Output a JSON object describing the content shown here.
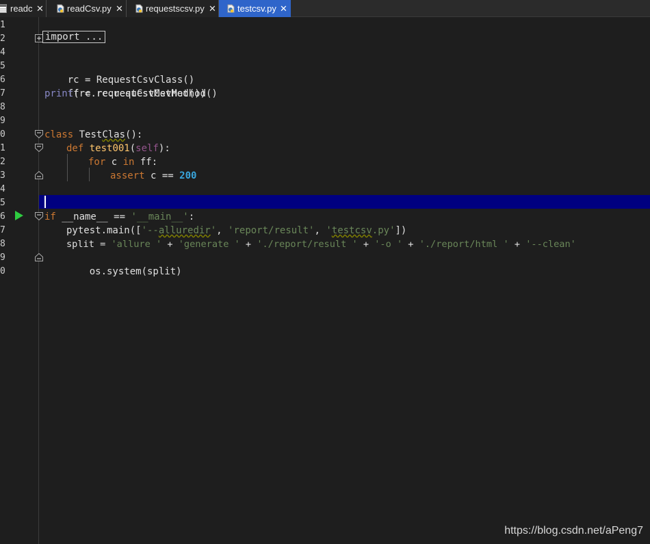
{
  "tabs": [
    {
      "label": "readc",
      "active": false
    },
    {
      "label": "readCsv.py",
      "active": false
    },
    {
      "label": "requestscsv.py",
      "active": false
    },
    {
      "label": "testcsv.py",
      "active": true
    }
  ],
  "tab_close_glyph": "✕",
  "line_numbers": [
    "1",
    "2",
    "4",
    "5",
    "6",
    "7",
    "8",
    "9",
    "0",
    "1",
    "2",
    "3",
    "4",
    "5",
    "6",
    "7",
    "8",
    "9",
    "0"
  ],
  "code": {
    "import_fold": "import ...",
    "l5_a": "rc = RequestCsvClass()",
    "l6_a": "ff = rc.requestCsvMethod()",
    "l7_print": "print",
    "l7_rest": "(rc.requestCsvMethod())",
    "l10_class": "class",
    "l10_name1": " Test",
    "l10_name2": "Clas",
    "l10_rest": "():",
    "l11_def": "def",
    "l11_fn": " test001",
    "l11_p1": "(",
    "l11_self": "self",
    "l11_p2": "):",
    "l12_for": "for",
    "l12_c": " c ",
    "l12_in": "in",
    "l12_ff": " ff:",
    "l13_assert": "assert",
    "l13_mid": " c == ",
    "l13_num": "200",
    "l16_if": "if",
    "l16_mid": " __name__ == ",
    "l16_str": "'__main__'",
    "l16_end": ":",
    "l17_a": "pytest.main([",
    "l17_s1a": "'--",
    "l17_s1b": "alluredir",
    "l17_s1c": "'",
    "l17_c1": ", ",
    "l17_s2": "'report/result'",
    "l17_c2": ", ",
    "l17_s3a": "'",
    "l17_s3b": "testcsv",
    "l17_s3c": ".py'",
    "l17_end": "])",
    "l18_a": "split = ",
    "l18_s1": "'allure '",
    "l18_p1": " + ",
    "l18_s2": "'generate '",
    "l18_p2": " + ",
    "l18_s3": "'./report/result '",
    "l18_p3": " + ",
    "l18_s4": "'-o '",
    "l18_p4": " + ",
    "l18_s5": "'./report/html '",
    "l18_p5": " + ",
    "l18_s6": "'--clean'",
    "l19_a": "os.system(split)"
  },
  "watermark": "https://blog.csdn.net/aPeng7",
  "colors": {
    "keyword": "#cc7832",
    "function": "#ffc66d",
    "string": "#6a8759",
    "number": "#39a5dc",
    "current_line": "#000080",
    "active_tab": "#2f65ca"
  }
}
